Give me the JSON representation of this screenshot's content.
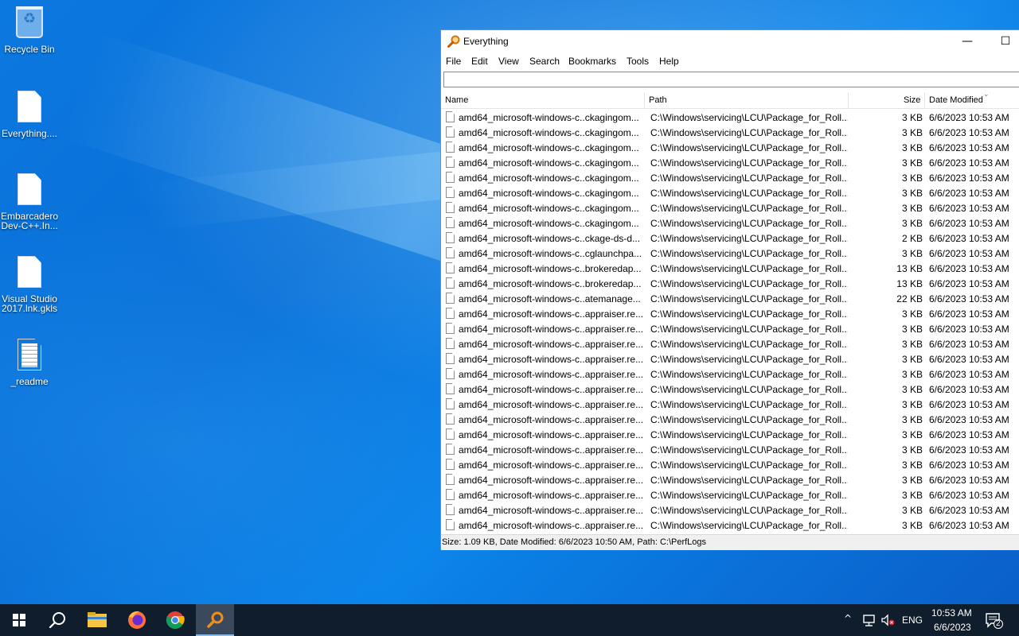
{
  "desktop": {
    "icons": [
      {
        "label": "Recycle Bin"
      },
      {
        "label": "Everything...."
      },
      {
        "label": "Embarcadero Dev-C++.In..."
      },
      {
        "label": "Visual Studio 2017.lnk.gkls"
      },
      {
        "label": "_readme"
      }
    ]
  },
  "window": {
    "title": "Everything",
    "minimize_glyph": "—",
    "maximize_glyph": "☐",
    "menu": [
      "File",
      "Edit",
      "View",
      "Search",
      "Bookmarks",
      "Tools",
      "Help"
    ],
    "search": {
      "value": "",
      "placeholder": ""
    },
    "columns": {
      "name": "Name",
      "path": "Path",
      "size": "Size",
      "date": "Date Modified"
    },
    "rows": [
      {
        "name": "amd64_microsoft-windows-c..ckagingom...",
        "path": "C:\\Windows\\servicing\\LCU\\Package_for_Roll...",
        "size": "3 KB",
        "date": "6/6/2023 10:53 AM"
      },
      {
        "name": "amd64_microsoft-windows-c..ckagingom...",
        "path": "C:\\Windows\\servicing\\LCU\\Package_for_Roll...",
        "size": "3 KB",
        "date": "6/6/2023 10:53 AM"
      },
      {
        "name": "amd64_microsoft-windows-c..ckagingom...",
        "path": "C:\\Windows\\servicing\\LCU\\Package_for_Roll...",
        "size": "3 KB",
        "date": "6/6/2023 10:53 AM"
      },
      {
        "name": "amd64_microsoft-windows-c..ckagingom...",
        "path": "C:\\Windows\\servicing\\LCU\\Package_for_Roll...",
        "size": "3 KB",
        "date": "6/6/2023 10:53 AM"
      },
      {
        "name": "amd64_microsoft-windows-c..ckagingom...",
        "path": "C:\\Windows\\servicing\\LCU\\Package_for_Roll...",
        "size": "3 KB",
        "date": "6/6/2023 10:53 AM"
      },
      {
        "name": "amd64_microsoft-windows-c..ckagingom...",
        "path": "C:\\Windows\\servicing\\LCU\\Package_for_Roll...",
        "size": "3 KB",
        "date": "6/6/2023 10:53 AM"
      },
      {
        "name": "amd64_microsoft-windows-c..ckagingom...",
        "path": "C:\\Windows\\servicing\\LCU\\Package_for_Roll...",
        "size": "3 KB",
        "date": "6/6/2023 10:53 AM"
      },
      {
        "name": "amd64_microsoft-windows-c..ckagingom...",
        "path": "C:\\Windows\\servicing\\LCU\\Package_for_Roll...",
        "size": "3 KB",
        "date": "6/6/2023 10:53 AM"
      },
      {
        "name": "amd64_microsoft-windows-c..ckage-ds-d...",
        "path": "C:\\Windows\\servicing\\LCU\\Package_for_Roll...",
        "size": "2 KB",
        "date": "6/6/2023 10:53 AM"
      },
      {
        "name": "amd64_microsoft-windows-c..cglaunchpa...",
        "path": "C:\\Windows\\servicing\\LCU\\Package_for_Roll...",
        "size": "3 KB",
        "date": "6/6/2023 10:53 AM"
      },
      {
        "name": "amd64_microsoft-windows-c..brokeredap...",
        "path": "C:\\Windows\\servicing\\LCU\\Package_for_Roll...",
        "size": "13 KB",
        "date": "6/6/2023 10:53 AM"
      },
      {
        "name": "amd64_microsoft-windows-c..brokeredap...",
        "path": "C:\\Windows\\servicing\\LCU\\Package_for_Roll...",
        "size": "13 KB",
        "date": "6/6/2023 10:53 AM"
      },
      {
        "name": "amd64_microsoft-windows-c..atemanage...",
        "path": "C:\\Windows\\servicing\\LCU\\Package_for_Roll...",
        "size": "22 KB",
        "date": "6/6/2023 10:53 AM"
      },
      {
        "name": "amd64_microsoft-windows-c..appraiser.re...",
        "path": "C:\\Windows\\servicing\\LCU\\Package_for_Roll...",
        "size": "3 KB",
        "date": "6/6/2023 10:53 AM"
      },
      {
        "name": "amd64_microsoft-windows-c..appraiser.re...",
        "path": "C:\\Windows\\servicing\\LCU\\Package_for_Roll...",
        "size": "3 KB",
        "date": "6/6/2023 10:53 AM"
      },
      {
        "name": "amd64_microsoft-windows-c..appraiser.re...",
        "path": "C:\\Windows\\servicing\\LCU\\Package_for_Roll...",
        "size": "3 KB",
        "date": "6/6/2023 10:53 AM"
      },
      {
        "name": "amd64_microsoft-windows-c..appraiser.re...",
        "path": "C:\\Windows\\servicing\\LCU\\Package_for_Roll...",
        "size": "3 KB",
        "date": "6/6/2023 10:53 AM"
      },
      {
        "name": "amd64_microsoft-windows-c..appraiser.re...",
        "path": "C:\\Windows\\servicing\\LCU\\Package_for_Roll...",
        "size": "3 KB",
        "date": "6/6/2023 10:53 AM"
      },
      {
        "name": "amd64_microsoft-windows-c..appraiser.re...",
        "path": "C:\\Windows\\servicing\\LCU\\Package_for_Roll...",
        "size": "3 KB",
        "date": "6/6/2023 10:53 AM"
      },
      {
        "name": "amd64_microsoft-windows-c..appraiser.re...",
        "path": "C:\\Windows\\servicing\\LCU\\Package_for_Roll...",
        "size": "3 KB",
        "date": "6/6/2023 10:53 AM"
      },
      {
        "name": "amd64_microsoft-windows-c..appraiser.re...",
        "path": "C:\\Windows\\servicing\\LCU\\Package_for_Roll...",
        "size": "3 KB",
        "date": "6/6/2023 10:53 AM"
      },
      {
        "name": "amd64_microsoft-windows-c..appraiser.re...",
        "path": "C:\\Windows\\servicing\\LCU\\Package_for_Roll...",
        "size": "3 KB",
        "date": "6/6/2023 10:53 AM"
      },
      {
        "name": "amd64_microsoft-windows-c..appraiser.re...",
        "path": "C:\\Windows\\servicing\\LCU\\Package_for_Roll...",
        "size": "3 KB",
        "date": "6/6/2023 10:53 AM"
      },
      {
        "name": "amd64_microsoft-windows-c..appraiser.re...",
        "path": "C:\\Windows\\servicing\\LCU\\Package_for_Roll...",
        "size": "3 KB",
        "date": "6/6/2023 10:53 AM"
      },
      {
        "name": "amd64_microsoft-windows-c..appraiser.re...",
        "path": "C:\\Windows\\servicing\\LCU\\Package_for_Roll...",
        "size": "3 KB",
        "date": "6/6/2023 10:53 AM"
      },
      {
        "name": "amd64_microsoft-windows-c..appraiser.re...",
        "path": "C:\\Windows\\servicing\\LCU\\Package_for_Roll...",
        "size": "3 KB",
        "date": "6/6/2023 10:53 AM"
      },
      {
        "name": "amd64_microsoft-windows-c..appraiser.re...",
        "path": "C:\\Windows\\servicing\\LCU\\Package_for_Roll...",
        "size": "3 KB",
        "date": "6/6/2023 10:53 AM"
      },
      {
        "name": "amd64_microsoft-windows-c..appraiser.re...",
        "path": "C:\\Windows\\servicing\\LCU\\Package_for_Roll...",
        "size": "3 KB",
        "date": "6/6/2023 10:53 AM"
      }
    ],
    "status": "Size: 1.09 KB, Date Modified: 6/6/2023 10:50 AM, Path: C:\\PerfLogs"
  },
  "taskbar": {
    "apps": [
      "start-button",
      "search-button",
      "file-explorer",
      "firefox",
      "chrome",
      "everything"
    ],
    "active_app": "everything",
    "tray": {
      "language": "ENG",
      "time": "10:53 AM",
      "date": "6/6/2023",
      "notification_count": "2"
    }
  },
  "colors": {
    "taskbar_bg": "#0f1d2c",
    "desktop_blue": "#0a6fd6",
    "everything_orange": "#f28c1b"
  }
}
